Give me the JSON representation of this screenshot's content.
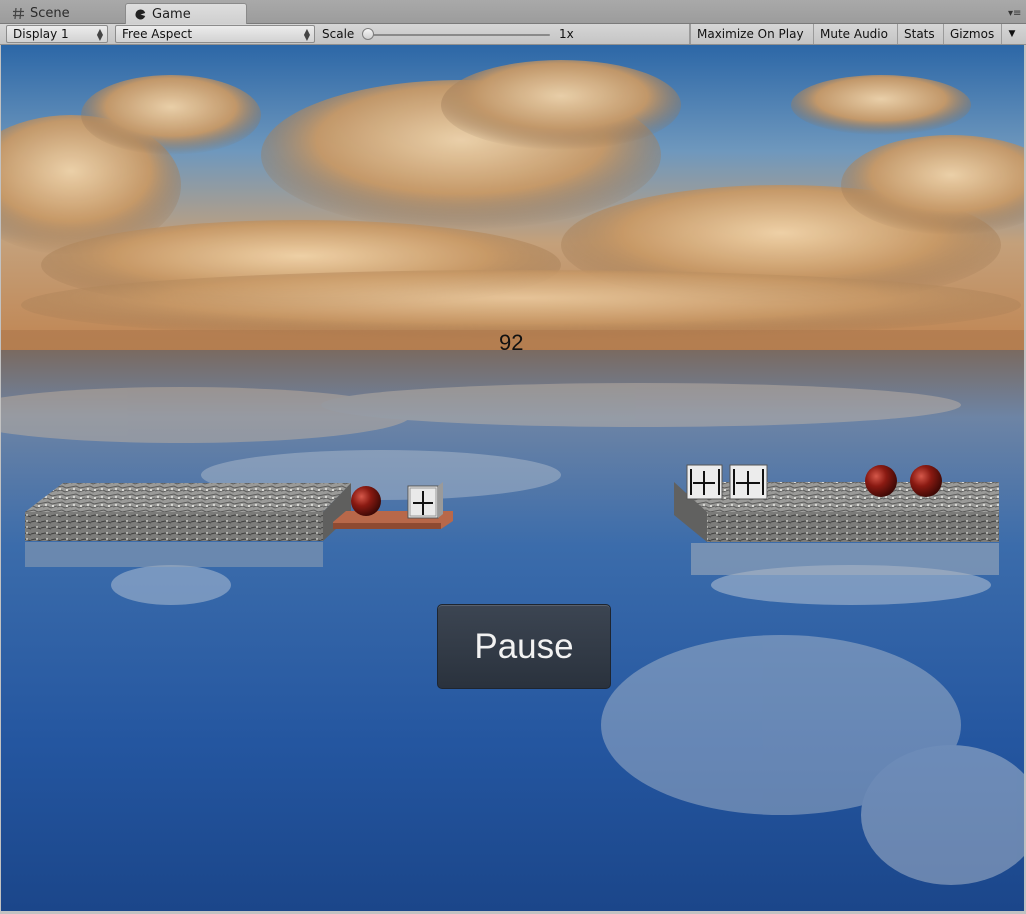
{
  "tabs": [
    {
      "label": "Scene",
      "icon": "hash-icon",
      "active": false
    },
    {
      "label": "Game",
      "icon": "pacman-icon",
      "active": true
    }
  ],
  "toolbar": {
    "display_select": "Display 1",
    "aspect_select": "Free Aspect",
    "scale_label": "Scale",
    "scale_value": "1x",
    "maximize_on_play": "Maximize On Play",
    "mute_audio": "Mute Audio",
    "stats": "Stats",
    "gizmos": "Gizmos"
  },
  "game": {
    "counter": "92",
    "pause_label": "Pause"
  },
  "colors": {
    "sky_top": "#2f6aa8",
    "horizon": "#c9935c",
    "water": "#1e4f96",
    "ball": "#8a1a12",
    "button_bg": "#2f3743"
  }
}
